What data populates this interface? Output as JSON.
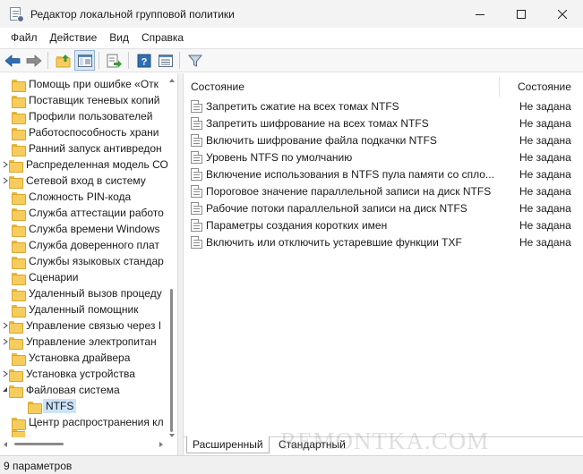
{
  "window": {
    "title": "Редактор локальной групповой политики"
  },
  "menu": [
    "Файл",
    "Действие",
    "Вид",
    "Справка"
  ],
  "toolbar": {
    "buttons": [
      "back-icon",
      "forward-icon",
      "up-folder-icon",
      "show-hide-tree-icon",
      "export-list-icon",
      "help-icon",
      "properties-view-icon",
      "filter-icon"
    ]
  },
  "tree": {
    "items": [
      {
        "label": "Помощь при ошибке «Отк"
      },
      {
        "label": "Поставщик теневых копий"
      },
      {
        "label": "Профили пользователей"
      },
      {
        "label": "Работоспособность храни"
      },
      {
        "label": "Ранний запуск антивредон"
      },
      {
        "label": "Распределенная модель СО"
      },
      {
        "label": "Сетевой вход в систему"
      },
      {
        "label": "Сложность PIN-кода"
      },
      {
        "label": "Служба аттестации работо"
      },
      {
        "label": "Служба времени Windows"
      },
      {
        "label": "Служба доверенного плат"
      },
      {
        "label": "Службы языковых стандар"
      },
      {
        "label": "Сценарии"
      },
      {
        "label": "Удаленный вызов процеду"
      },
      {
        "label": "Удаленный помощник"
      },
      {
        "label": "Управление связью через I"
      },
      {
        "label": "Управление электропитан"
      },
      {
        "label": "Установка драйвера"
      },
      {
        "label": "Установка устройства"
      },
      {
        "label": "Файловая система"
      },
      {
        "label": "NTFS"
      },
      {
        "label": "Центр распространения кл"
      }
    ]
  },
  "list": {
    "columns": {
      "name": "Состояние",
      "state": "Состояние"
    },
    "rows": [
      {
        "name": "Запретить сжатие на всех томах NTFS",
        "state": "Не задана"
      },
      {
        "name": "Запретить шифрование на всех томах NTFS",
        "state": "Не задана"
      },
      {
        "name": "Включить шифрование файла подкачки NTFS",
        "state": "Не задана"
      },
      {
        "name": "Уровень NTFS по умолчанию",
        "state": "Не задана"
      },
      {
        "name": "Включение использования в NTFS пула памяти со спло...",
        "state": "Не задана"
      },
      {
        "name": "Пороговое значение параллельной записи на диск NTFS",
        "state": "Не задана"
      },
      {
        "name": "Рабочие потоки параллельной записи на диск NTFS",
        "state": "Не задана"
      },
      {
        "name": "Параметры создания коротких имен",
        "state": "Не задана"
      },
      {
        "name": "Включить или отключить устаревшие функции TXF",
        "state": "Не задана"
      }
    ]
  },
  "tabs": {
    "extended": "Расширенный",
    "standard": "Стандартный"
  },
  "status": {
    "text": "9 параметров"
  },
  "watermark": "REMONTKA.COM",
  "colors": {
    "folder": "#f6cd5d",
    "selection": "#cce4f7",
    "toolbar_blue": "#2f6fb3"
  }
}
